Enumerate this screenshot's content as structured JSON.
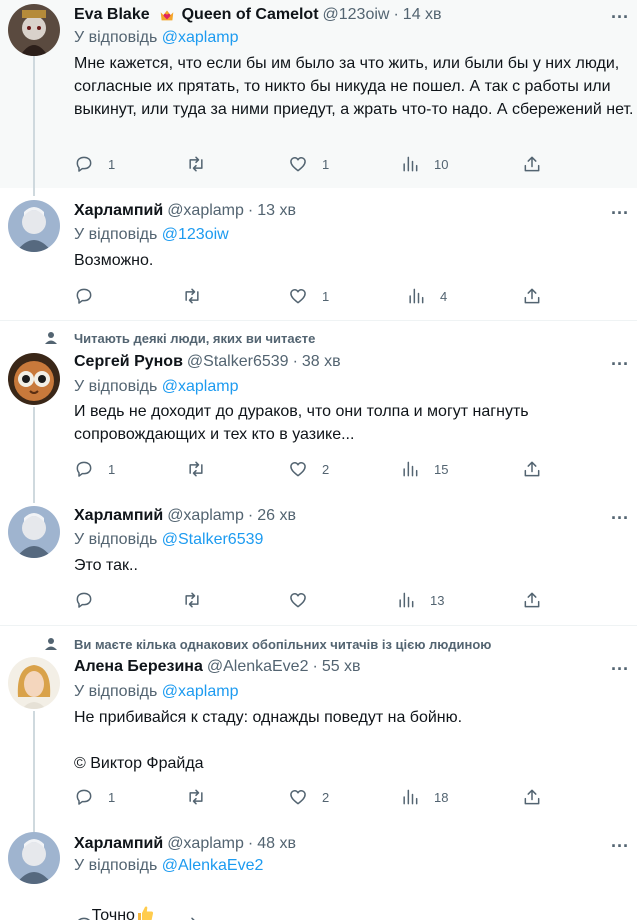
{
  "tweets": [
    {
      "name": "Eva Blake",
      "badge_name": "Queen of Camelot",
      "handle": "@123oiw",
      "dot": "·",
      "time": "14 хв",
      "reply_prefix": "У відповідь",
      "reply_to": "@xaplamp",
      "text": "Мне кажется, что если бы им было за что жить, или были бы у них люди, согласные их прятать, то никто бы никуда не пошел. А так с работы или выкинут, или туда за ними приедут, а жрать что-то надо. А сбережений нет.",
      "stats": {
        "replies": "1",
        "retweets": "",
        "likes": "1",
        "views": "10"
      }
    },
    {
      "name": "Харлампий",
      "handle": "@xaplamp",
      "dot": "·",
      "time": "13 хв",
      "reply_prefix": "У відповідь",
      "reply_to": "@123oiw",
      "text": "Возможно.",
      "stats": {
        "replies": "",
        "retweets": "",
        "likes": "1",
        "views": "4"
      }
    },
    {
      "social_context": "Читають деякі люди, яких ви читаєте",
      "name": "Сергей Рунов",
      "handle": "@Stalker6539",
      "dot": "·",
      "time": "38 хв",
      "reply_prefix": "У відповідь",
      "reply_to": "@xaplamp",
      "text": "И ведь не доходит до дураков, что они толпа и могут нагнуть сопровождающих и тех кто в уазике...",
      "stats": {
        "replies": "1",
        "retweets": "",
        "likes": "2",
        "views": "15"
      }
    },
    {
      "name": "Харлампий",
      "handle": "@xaplamp",
      "dot": "·",
      "time": "26 хв",
      "reply_prefix": "У відповідь",
      "reply_to": "@Stalker6539",
      "text": "Это так..",
      "stats": {
        "replies": "",
        "retweets": "",
        "likes": "",
        "views": "13"
      }
    },
    {
      "social_context": "Ви маєте кілька однакових обопільних читачів із цією людиною",
      "name": "Алена Березина",
      "handle": "@AlenkaEve2",
      "dot": "·",
      "time": "55 хв",
      "reply_prefix": "У відповідь",
      "reply_to": "@xaplamp",
      "text": "Не прибивайся к стаду: однажды поведут на бойню.\n\n© Виктор Фрайда",
      "stats": {
        "replies": "1",
        "retweets": "",
        "likes": "2",
        "views": "18"
      }
    },
    {
      "name": "Харлампий",
      "handle": "@xaplamp",
      "dot": "·",
      "time": "48 хв",
      "reply_prefix": "У відповідь",
      "reply_to": "@AlenkaEve2",
      "text": "Точно",
      "stats": {
        "replies": "",
        "retweets": "",
        "likes": "",
        "views": ""
      }
    }
  ],
  "icons": {
    "more": "more-icon",
    "reply": "reply-icon",
    "retweet": "retweet-icon",
    "like": "like-icon",
    "views": "views-icon",
    "share": "share-icon",
    "thumbs_up": "thumbs-up-emoji",
    "crown_heart": "crown-heart-icon",
    "person": "person-icon"
  },
  "colors": {
    "link": "#1d9bf0",
    "secondary_text": "#536471",
    "highlight_bg": "#f7f9f9",
    "thread_line": "#cfd9de"
  }
}
